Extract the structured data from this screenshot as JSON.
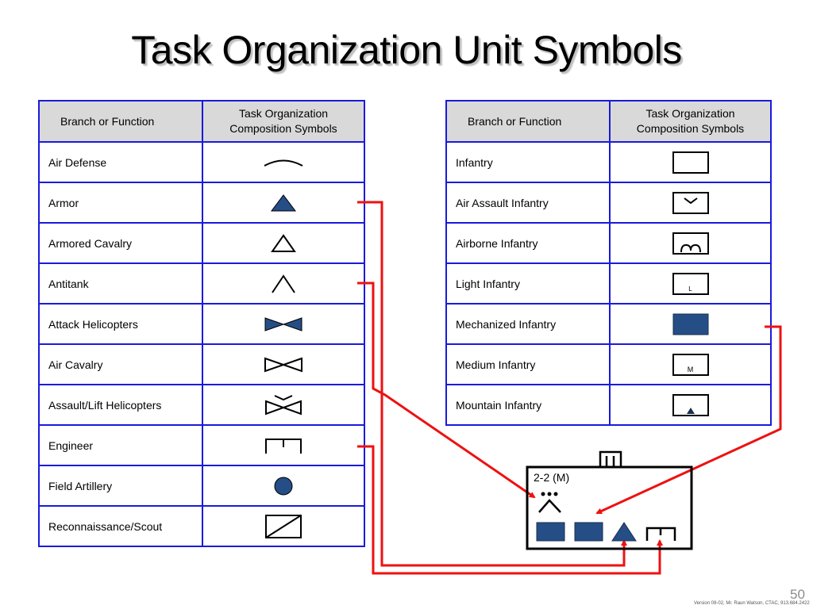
{
  "title": "Task Organization Unit Symbols",
  "colors": {
    "table_border": "#1a1adc",
    "header_bg": "#d9d9d9",
    "symbol_fill": "#254e86",
    "connector": "#ee1111"
  },
  "left_table": {
    "headers": [
      "Branch or Function",
      "Task Organization Composition Symbols"
    ],
    "header_symbol_line1": "Task Organization",
    "header_symbol_line2": "Composition Symbols",
    "rows": [
      {
        "label": "Air Defense",
        "symbol": "air-defense-arc-icon"
      },
      {
        "label": "Armor",
        "symbol": "armor-filled-triangle-icon"
      },
      {
        "label": "Armored Cavalry",
        "symbol": "armored-cavalry-outline-triangle-icon"
      },
      {
        "label": "Antitank",
        "symbol": "antitank-chevron-icon"
      },
      {
        "label": "Attack Helicopters",
        "symbol": "attack-helicopter-filled-bowtie-icon"
      },
      {
        "label": "Air Cavalry",
        "symbol": "air-cavalry-outline-bowtie-icon"
      },
      {
        "label": "Assault/Lift Helicopters",
        "symbol": "assault-lift-helicopter-bowtie-icon"
      },
      {
        "label": "Engineer",
        "symbol": "engineer-bracket-icon"
      },
      {
        "label": "Field Artillery",
        "symbol": "field-artillery-dot-icon"
      },
      {
        "label": "Reconnaissance/Scout",
        "symbol": "recon-slashed-box-icon"
      }
    ]
  },
  "right_table": {
    "headers": [
      "Branch or Function",
      "Task Organization Composition Symbols"
    ],
    "header_symbol_line1": "Task Organization",
    "header_symbol_line2": "Composition Symbols",
    "rows": [
      {
        "label": "Infantry",
        "symbol": "infantry-box-icon"
      },
      {
        "label": "Air Assault Infantry",
        "symbol": "air-assault-infantry-box-icon"
      },
      {
        "label": "Airborne Infantry",
        "symbol": "airborne-infantry-box-icon"
      },
      {
        "label": "Light Infantry",
        "symbol": "light-infantry-box-icon",
        "inner_text": "L"
      },
      {
        "label": "Mechanized Infantry",
        "symbol": "mechanized-infantry-filled-box-icon"
      },
      {
        "label": "Medium Infantry",
        "symbol": "medium-infantry-box-icon",
        "inner_text": "M"
      },
      {
        "label": "Mountain Infantry",
        "symbol": "mountain-infantry-box-icon"
      }
    ]
  },
  "unit_box": {
    "label": "2-2 (M)",
    "echelon": "company-echelon",
    "components": [
      "antitank (3 dots)",
      "mechanized infantry",
      "mechanized infantry",
      "armor",
      "engineer"
    ]
  },
  "footer": {
    "page_number": "50",
    "version": "Version 09-02, Mr. Raun Watson, CTAC, 913.684.2422"
  }
}
